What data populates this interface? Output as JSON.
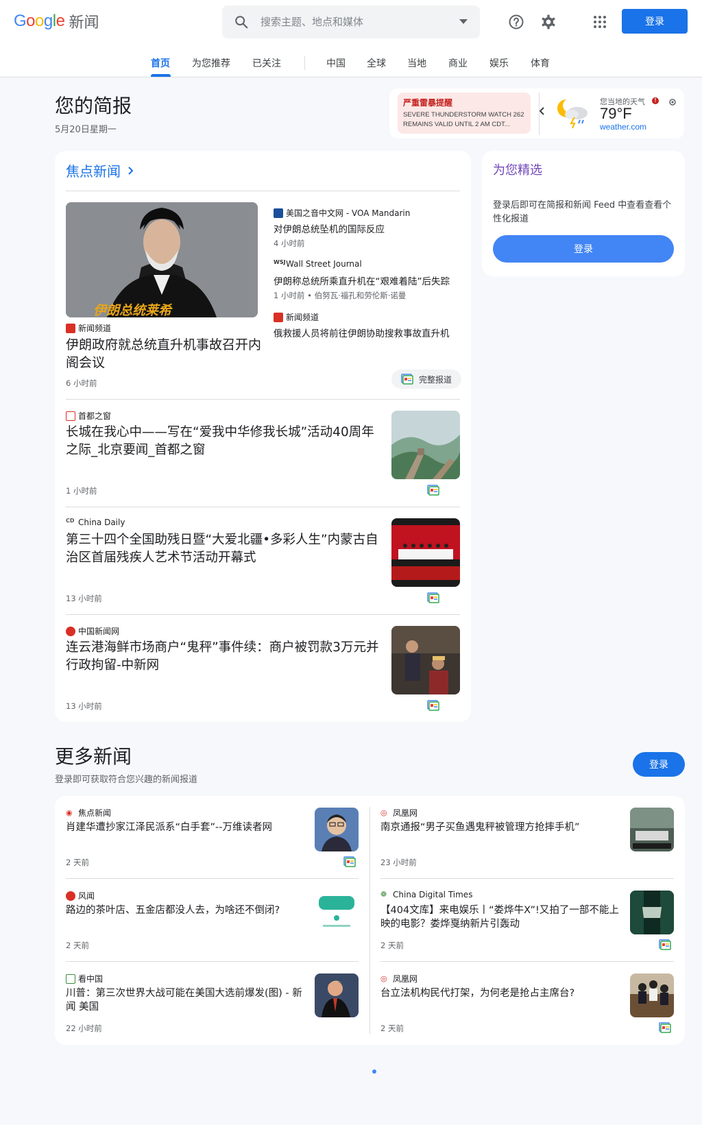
{
  "header": {
    "logo_text": "Google",
    "logo_suffix": "新闻",
    "search_placeholder": "搜索主题、地点和媒体",
    "signin_label": "登录"
  },
  "tabs": [
    {
      "label": "首页",
      "active": true
    },
    {
      "label": "为您推荐"
    },
    {
      "label": "已关注"
    },
    {
      "label": "中国"
    },
    {
      "label": "全球"
    },
    {
      "label": "当地"
    },
    {
      "label": "商业"
    },
    {
      "label": "娱乐"
    },
    {
      "label": "体育"
    }
  ],
  "briefing": {
    "title": "您的简报",
    "date": "5月20日星期一"
  },
  "alert": {
    "title": "严重雷暴提醒",
    "body": "SEVERE THUNDERSTORM WATCH 262 REMAINS VALID UNTIL 2 AM CDT..."
  },
  "weather": {
    "label": "您当地的天气",
    "temp": "79°F",
    "source": "weather.com"
  },
  "top_stories": {
    "heading": "焦点新闻",
    "full_coverage_label": "完整报道",
    "lead": {
      "source": "新闻频道",
      "title": "伊朗政府就总统直升机事故召开内阁会议",
      "time": "6 小时前",
      "image_caption": "伊朗总统莱希"
    },
    "related": [
      {
        "source": "美国之音中文网 - VOA Mandarin",
        "title": "对伊朗总统坠机的国际反应",
        "meta": "4 小时前"
      },
      {
        "source": "Wall Street Journal",
        "title": "伊朗称总统所乘直升机在“艰难着陆”后失踪",
        "meta": "1 小时前 • 伯努瓦·福孔和劳伦斯·诺曼"
      },
      {
        "source": "新闻频道",
        "title": "俄救援人员将前往伊朗协助搜救事故直升机",
        "meta": "1 小时前"
      }
    ],
    "stories": [
      {
        "source": "首都之窗",
        "title": "长城在我心中——写在“爱我中华修我长城”活动40周年之际_北京要闻_首都之窗",
        "time": "1 小时前"
      },
      {
        "source": "China Daily",
        "title": "第三十四个全国助残日暨“大爱北疆•多彩人生”内蒙古自治区首届残疾人艺术节活动开幕式",
        "time": "13 小时前"
      },
      {
        "source": "中国新闻网",
        "title": "连云港海鲜市场商户“鬼秤”事件续：商户被罚款3万元并行政拘留-中新网",
        "time": "13 小时前"
      }
    ]
  },
  "picks": {
    "title": "为您精选",
    "text": "登录后即可在简报和新闻 Feed 中查看查看个性化报道",
    "button": "登录"
  },
  "more_news": {
    "title": "更多新闻",
    "subtitle": "登录即可获取符合您兴趣的新闻报道",
    "button": "登录",
    "left": [
      {
        "source": "焦点新闻",
        "title": "肖建华遭抄家江泽民派系“白手套”--万维读者网",
        "time": "2 天前"
      },
      {
        "source": "风闻",
        "title": "路边的茶叶店、五金店都没人去，为啥还不倒闭?",
        "time": "2 天前"
      },
      {
        "source": "看中国",
        "title": "川普：第三次世界大战可能在美国大选前爆发(图) - 新闻 美国",
        "time": "22 小时前"
      }
    ],
    "right": [
      {
        "source": "凤凰网",
        "title": "南京通报“男子买鱼遇鬼秤被管理方抢摔手机”",
        "time": "23 小时前"
      },
      {
        "source": "China Digital Times",
        "title": "【404文库】来电娱乐丨“娄烨牛X”!又拍了一部不能上映的电影？娄烨戛纳新片引轰动",
        "time": "2 天前"
      },
      {
        "source": "凤凰网",
        "title": "台立法机构民代打架，为何老是抢占主席台?",
        "time": "2 天前"
      }
    ]
  },
  "colors": {
    "accent": "#1a73e8",
    "alert_bg": "#fce8e6",
    "alert_text": "#c5221f",
    "picks_title": "#7248b9"
  }
}
